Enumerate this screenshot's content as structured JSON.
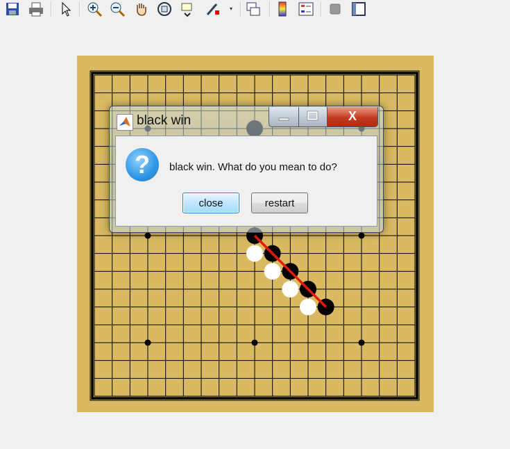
{
  "toolbar": {
    "icons": [
      "save-icon",
      "print-icon",
      "pointer-icon",
      "zoom-in-icon",
      "zoom-out-icon",
      "pan-hand-icon",
      "rotate-3d-icon",
      "data-cursor-icon",
      "brush-icon",
      "link-plot-icon",
      "colorbar-icon",
      "legend-icon",
      "hide-plot-tools-icon",
      "show-plot-tools-icon"
    ]
  },
  "board": {
    "size": 19,
    "background": "#d9b962",
    "star_points": [
      [
        3,
        3
      ],
      [
        9,
        3
      ],
      [
        15,
        3
      ],
      [
        3,
        9
      ],
      [
        9,
        9
      ],
      [
        15,
        9
      ],
      [
        3,
        15
      ],
      [
        9,
        15
      ],
      [
        15,
        15
      ]
    ],
    "black_stones": [
      [
        9,
        9
      ],
      [
        10,
        10
      ],
      [
        11,
        11
      ],
      [
        12,
        12
      ],
      [
        13,
        13
      ],
      [
        9,
        3
      ]
    ],
    "white_stones": [
      [
        9,
        10
      ],
      [
        10,
        11
      ],
      [
        11,
        12
      ],
      [
        12,
        13
      ]
    ],
    "win_line": {
      "from": [
        9,
        9
      ],
      "to": [
        13,
        13
      ],
      "color": "#e8190b"
    }
  },
  "dialog": {
    "title": "black win",
    "message": "black win. What do you mean to do?",
    "buttons": {
      "close": "close",
      "restart": "restart"
    },
    "window_controls": {
      "minimize": "—",
      "maximize": "□",
      "close": "X"
    }
  }
}
